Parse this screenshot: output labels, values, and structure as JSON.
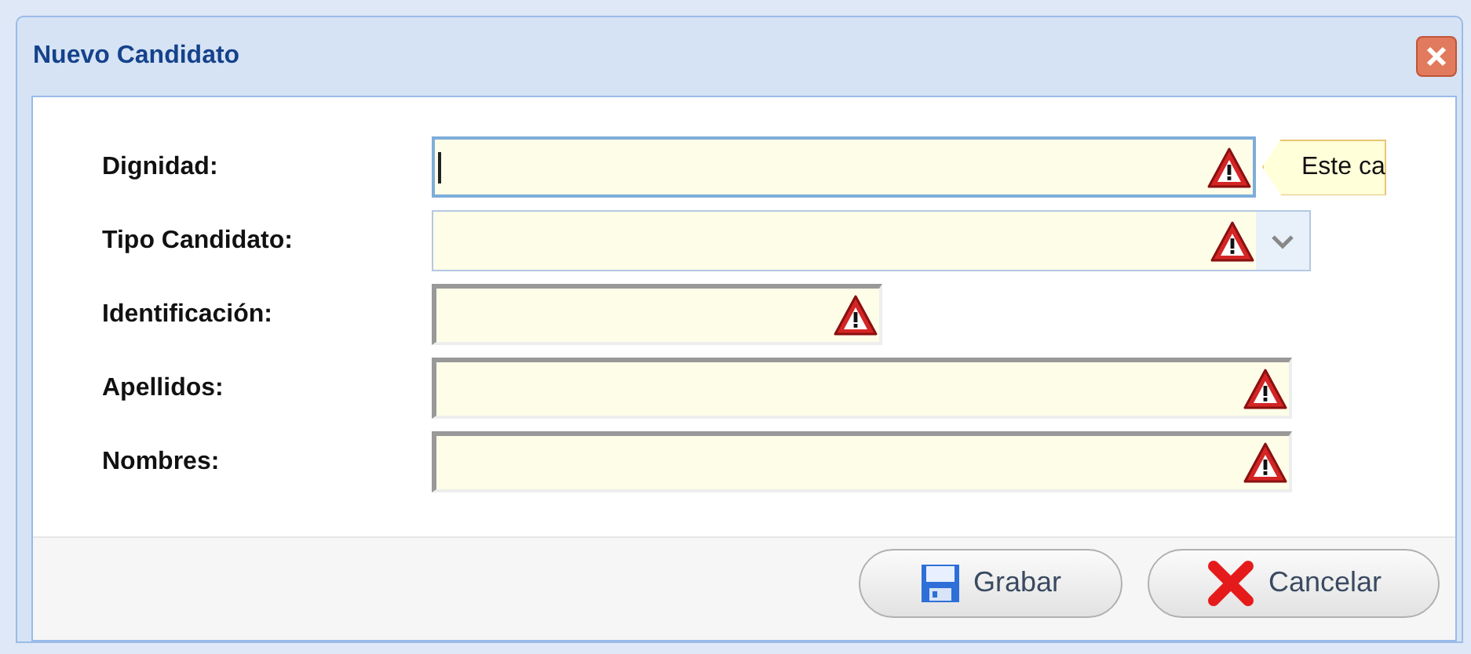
{
  "window": {
    "title": "Nuevo Candidato"
  },
  "fields": [
    {
      "label": "Dignidad:",
      "kind": "text",
      "focused": true,
      "invalid": true,
      "error_tip": "Este ca"
    },
    {
      "label": "Tipo Candidato:",
      "kind": "combo",
      "focused": false,
      "invalid": true
    },
    {
      "label": "Identificación:",
      "kind": "text",
      "focused": false,
      "invalid": true
    },
    {
      "label": "Apellidos:",
      "kind": "text",
      "focused": false,
      "invalid": true
    },
    {
      "label": "Nombres:",
      "kind": "text",
      "focused": false,
      "invalid": true
    }
  ],
  "buttons": [
    {
      "label": "Grabar",
      "kind": "save"
    },
    {
      "label": "Cancelar",
      "kind": "cancel"
    }
  ]
}
